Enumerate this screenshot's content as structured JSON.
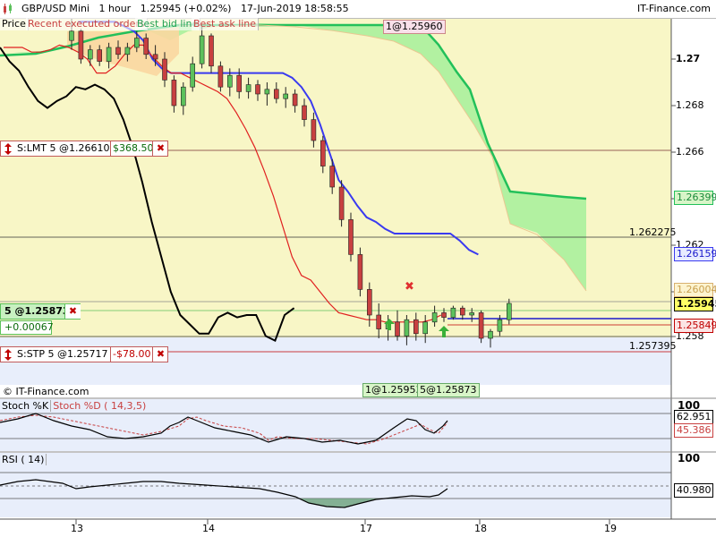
{
  "window": {
    "title_symbol": "GBP/USD Mini",
    "title_interval": "1 hour",
    "title_price": "1.25945 (+0.02%)",
    "title_datetime": "17-Jun-2019 18:58:55",
    "brand": "IT-Finance.com",
    "watermark": "© IT-Finance.com"
  },
  "legend": {
    "price": "Price",
    "recent": "Recent executed orders",
    "bid": "Best bid line",
    "ask": "Best ask line"
  },
  "colors": {
    "plot_bg": "#f8f6c6",
    "cloud_green": "#a6f09a",
    "cloud_orange": "#fad7a0",
    "up_candle": "#5cc15c",
    "down_candle": "#c84040",
    "kijun": "#3a3af0",
    "tenkan": "#e02020",
    "chikou": "#000000",
    "span_b": "#22c05a",
    "order_red": "#c00000",
    "bid_blue": "#1a1acc"
  },
  "orders": {
    "top_ask_label": "1@1.25960",
    "limit": {
      "label": "S:LMT  5 @1.26610",
      "pnl": "$368.50"
    },
    "position": {
      "label": "5 @1.25873",
      "pnl": "+0.00067"
    },
    "stop": {
      "label": "S:STP  5 @1.25717",
      "pnl": "-$78.00"
    },
    "close_icon": "✖",
    "sell_marker": "✖",
    "bottom_bid": "1@1.25953",
    "bottom_pos": "5@1.25873"
  },
  "levels": {
    "resistance": "1.262275",
    "support": "1.257395"
  },
  "price_axis": {
    "ticks": [
      "1.27",
      "1.268",
      "1.266",
      "1.264",
      "1.262",
      "1.26",
      "1.258"
    ],
    "labels": {
      "span_b": "1.26399",
      "kijun": "1.26159",
      "span_a": "1.26004",
      "last": "1.25945",
      "ask": "1.25849"
    }
  },
  "stochastic": {
    "title_k": "Stoch %K",
    "title_d": "Stoch %D ( 14,3,5)",
    "top": "100",
    "k_value": "62.951",
    "d_value": "45.386"
  },
  "rsi": {
    "title": "RSI ( 14)",
    "top": "100",
    "value": "40.980"
  },
  "time_axis": {
    "labels": [
      "13",
      "14",
      "17",
      "18",
      "19"
    ]
  },
  "chart_data": {
    "type": "candlestick",
    "title": "GBP/USD Mini  1 hour",
    "ylim": [
      1.2573,
      1.2725
    ],
    "x_labels": [
      "13",
      "14",
      "17",
      "18",
      "19"
    ],
    "series": [
      {
        "name": "Price",
        "ohlc": [
          [
            1.2708,
            1.2718,
            1.2704,
            1.2712
          ],
          [
            1.2712,
            1.2713,
            1.2698,
            1.27
          ],
          [
            1.27,
            1.2706,
            1.2697,
            1.2704
          ],
          [
            1.2704,
            1.2706,
            1.2697,
            1.2699
          ],
          [
            1.2699,
            1.2707,
            1.2696,
            1.2705
          ],
          [
            1.2705,
            1.2708,
            1.27,
            1.2702
          ],
          [
            1.2702,
            1.2707,
            1.2699,
            1.2705
          ],
          [
            1.2705,
            1.2712,
            1.2703,
            1.2709
          ],
          [
            1.2709,
            1.2711,
            1.27,
            1.2702
          ],
          [
            1.2702,
            1.2706,
            1.2697,
            1.27
          ],
          [
            1.27,
            1.2703,
            1.2688,
            1.2691
          ],
          [
            1.2691,
            1.2693,
            1.2677,
            1.268
          ],
          [
            1.268,
            1.269,
            1.2676,
            1.2688
          ],
          [
            1.2688,
            1.2701,
            1.2686,
            1.2698
          ],
          [
            1.2698,
            1.2714,
            1.2696,
            1.271
          ],
          [
            1.271,
            1.2711,
            1.2694,
            1.2697
          ],
          [
            1.2697,
            1.2699,
            1.2686,
            1.2688
          ],
          [
            1.2688,
            1.2696,
            1.2684,
            1.2693
          ],
          [
            1.2693,
            1.2696,
            1.2683,
            1.2686
          ],
          [
            1.2686,
            1.2692,
            1.2683,
            1.2689
          ],
          [
            1.2689,
            1.2691,
            1.2682,
            1.2685
          ],
          [
            1.2685,
            1.269,
            1.268,
            1.2687
          ],
          [
            1.2687,
            1.269,
            1.2681,
            1.2683
          ],
          [
            1.2683,
            1.2688,
            1.2679,
            1.2685
          ],
          [
            1.2685,
            1.2687,
            1.2677,
            1.268
          ],
          [
            1.268,
            1.2683,
            1.2671,
            1.2674
          ],
          [
            1.2674,
            1.2677,
            1.2662,
            1.2665
          ],
          [
            1.2665,
            1.2667,
            1.2651,
            1.2654
          ],
          [
            1.2654,
            1.2657,
            1.2642,
            1.2645
          ],
          [
            1.2645,
            1.2648,
            1.2628,
            1.2631
          ],
          [
            1.2631,
            1.2634,
            1.2613,
            1.2616
          ],
          [
            1.2616,
            1.2619,
            1.2598,
            1.2601
          ],
          [
            1.2601,
            1.2604,
            1.2585,
            1.259
          ],
          [
            1.259,
            1.2595,
            1.258,
            1.2584
          ],
          [
            1.2584,
            1.259,
            1.2579,
            1.2587
          ],
          [
            1.2587,
            1.2592,
            1.2579,
            1.2581
          ],
          [
            1.2581,
            1.259,
            1.2577,
            1.2588
          ],
          [
            1.2588,
            1.2591,
            1.2579,
            1.2582
          ],
          [
            1.2582,
            1.259,
            1.2578,
            1.2587
          ],
          [
            1.2587,
            1.2594,
            1.2585,
            1.2591
          ],
          [
            1.2591,
            1.2593,
            1.2587,
            1.2589
          ],
          [
            1.2589,
            1.2594,
            1.2588,
            1.2593
          ],
          [
            1.2593,
            1.2594,
            1.2588,
            1.259
          ],
          [
            1.259,
            1.2593,
            1.2587,
            1.2591
          ],
          [
            1.2591,
            1.2592,
            1.2578,
            1.258
          ],
          [
            1.258,
            1.2584,
            1.2576,
            1.2583
          ],
          [
            1.2583,
            1.259,
            1.2581,
            1.2588
          ],
          [
            1.2588,
            1.2597,
            1.2586,
            1.2595
          ]
        ]
      },
      {
        "name": "Kijun-sen",
        "values": [
          1.2716,
          1.2716,
          1.2716,
          1.2716,
          1.2716,
          1.2714,
          1.2712,
          1.2708,
          1.27,
          1.2696,
          1.2694,
          1.2694,
          1.2694,
          1.2694,
          1.2694,
          1.2694,
          1.2694,
          1.2694,
          1.2694,
          1.2694,
          1.2694,
          1.2694,
          1.2694,
          1.2692,
          1.2688,
          1.2682,
          1.2672,
          1.266,
          1.2648,
          1.2643,
          1.2637,
          1.2632,
          1.263,
          1.2627,
          1.2625,
          1.2625,
          1.2625,
          1.2625,
          1.2625,
          1.2625,
          1.2625,
          1.2622,
          1.2618,
          1.2616
        ]
      },
      {
        "name": "Tenkan-sen",
        "values": [
          1.2705,
          1.2705,
          1.2705,
          1.2703,
          1.2703,
          1.2704,
          1.2706,
          1.2705,
          1.2703,
          1.27,
          1.2694,
          1.2694,
          1.2697,
          1.2702,
          1.2706,
          1.2706,
          1.2701,
          1.2697,
          1.2694,
          1.2694,
          1.2692,
          1.269,
          1.2688,
          1.2686,
          1.2683,
          1.2677,
          1.267,
          1.2662,
          1.2652,
          1.2641,
          1.2628,
          1.2615,
          1.2607,
          1.2605,
          1.26,
          1.2595,
          1.2591,
          1.259,
          1.2589,
          1.2588,
          1.2588,
          1.2587,
          1.2587,
          1.2587,
          1.2587,
          1.2587,
          1.2588,
          1.259
        ]
      },
      {
        "name": "Chikou",
        "values": [
          1.2705,
          1.2699,
          1.2695,
          1.2688,
          1.2682,
          1.2679,
          1.2682,
          1.2684,
          1.2688,
          1.2687,
          1.2689,
          1.2687,
          1.2683,
          1.2674,
          1.2662,
          1.2647,
          1.263,
          1.2615,
          1.26,
          1.259,
          1.2586,
          1.2582,
          1.2582,
          1.2589,
          1.2591,
          1.2589,
          1.259,
          1.259,
          1.2581,
          1.2579,
          1.259,
          1.2593
        ]
      }
    ],
    "stochastic": {
      "k_last": 62.951,
      "d_last": 45.386
    },
    "rsi": {
      "last": 40.98
    }
  }
}
